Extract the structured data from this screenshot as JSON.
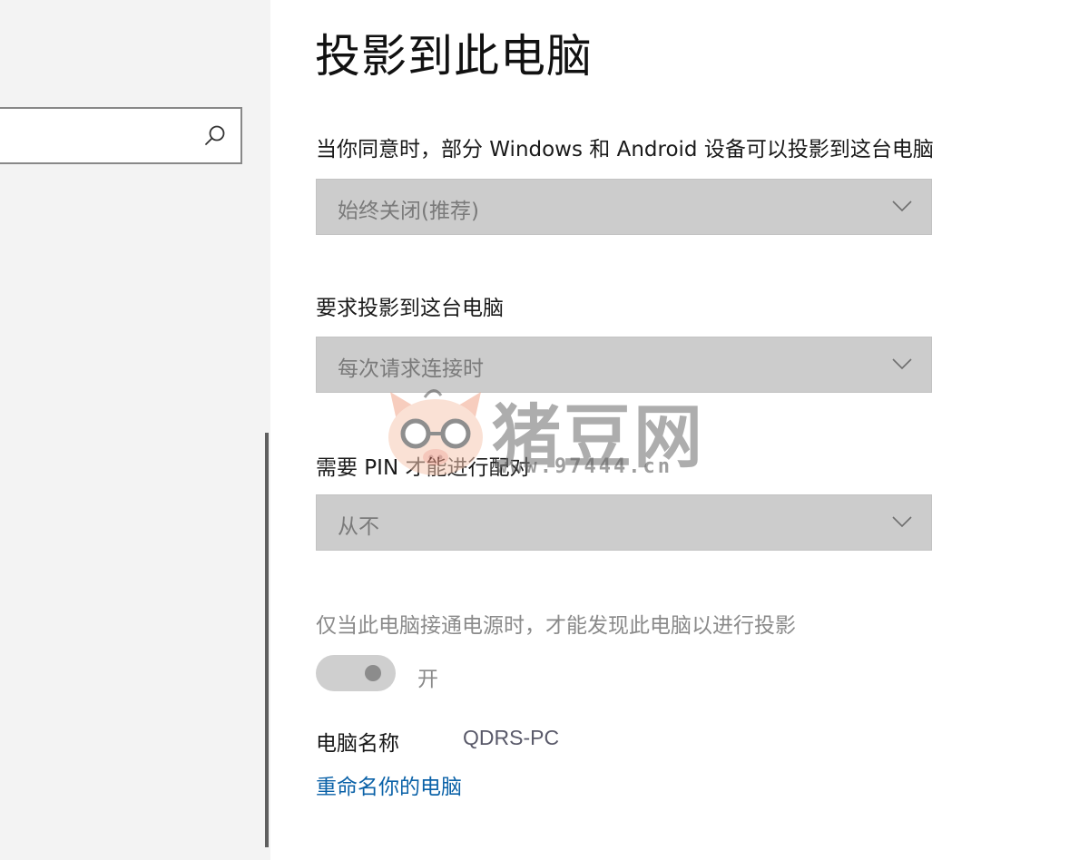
{
  "sidebar": {
    "search": {
      "value": "",
      "placeholder": "",
      "icon": "search-icon"
    }
  },
  "main": {
    "title": "投影到此电脑",
    "settings": [
      {
        "label": "当你同意时，部分 Windows 和 Android 设备可以投影到这台电脑",
        "value": "始终关闭(推荐)"
      },
      {
        "label": "要求投影到这台电脑",
        "value": "每次请求连接时"
      },
      {
        "label": "需要 PIN 才能进行配对",
        "value": "从不"
      }
    ],
    "power_note": "仅当此电脑接通电源时，才能发现此电脑以进行投影",
    "toggle": {
      "state_label": "开",
      "on": true
    },
    "pc_name": {
      "label": "电脑名称",
      "value": "QDRS-PC"
    },
    "rename_link": "重命名你的电脑"
  },
  "watermark": {
    "text": "猪豆网",
    "url": "www.97444.cn"
  },
  "colors": {
    "sidebar_bg": "#f3f3f3",
    "dropdown_bg": "#cccccc",
    "link": "#0b62a8",
    "disabled_text": "#8a8a8a"
  }
}
